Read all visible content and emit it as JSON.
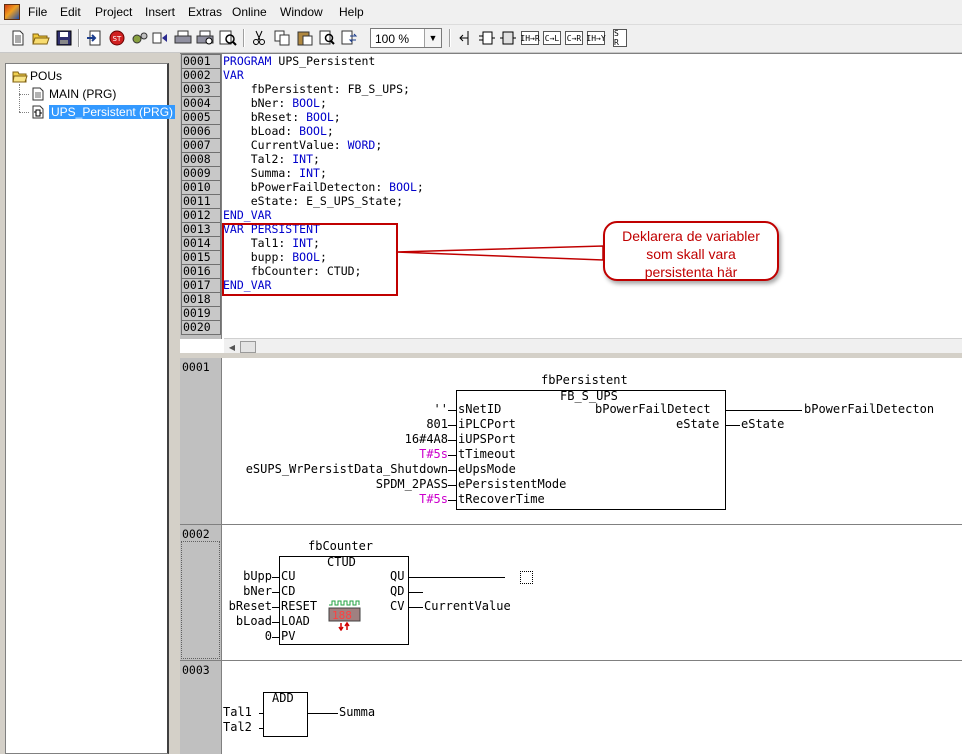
{
  "menu": [
    "File",
    "Edit",
    "Project",
    "Insert",
    "Extras",
    "Online",
    "Window",
    "Help"
  ],
  "toolbar": {
    "zoom": "100 %",
    "buttons": [
      "new-icon",
      "open-icon",
      "save-icon",
      "login-icon",
      "stop-icon",
      "build-icon",
      "print-icon",
      "print-preview-icon",
      "run-icon",
      "cut-icon",
      "copy-icon",
      "paste-icon",
      "find-icon",
      "find-next-icon",
      "insert-network-icon",
      "insert-box-icon",
      "insert-input-icon",
      "insert-contact-icon",
      "insert-coil-icon",
      "insert-negation-icon",
      "insert-jump-icon",
      "insert-set-reset-icon"
    ],
    "button_glyphs": [
      "IH→R",
      "C→L",
      "C→R",
      "IH→Y",
      "S R"
    ]
  },
  "tree": {
    "root": "POUs",
    "items": [
      "MAIN (PRG)",
      "UPS_Persistent (PRG)"
    ],
    "selected_index": 1
  },
  "declaration": {
    "line_numbers": [
      "0001",
      "0002",
      "0003",
      "0004",
      "0005",
      "0006",
      "0007",
      "0008",
      "0009",
      "0010",
      "0011",
      "0012",
      "0013",
      "0014",
      "0015",
      "0016",
      "0017",
      "0018",
      "0019",
      "0020"
    ],
    "lines": [
      [
        {
          "t": "PROGRAM ",
          "k": "kw"
        },
        {
          "t": "UPS_Persistent",
          "k": ""
        }
      ],
      [
        {
          "t": "VAR",
          "k": "kw"
        }
      ],
      [
        {
          "t": "    fbPersistent: FB_S_UPS;",
          "k": ""
        }
      ],
      [
        {
          "t": "    bNer: ",
          "k": ""
        },
        {
          "t": "BOOL",
          "k": "kw"
        },
        {
          "t": ";",
          "k": ""
        }
      ],
      [
        {
          "t": "    bReset: ",
          "k": ""
        },
        {
          "t": "BOOL",
          "k": "kw"
        },
        {
          "t": ";",
          "k": ""
        }
      ],
      [
        {
          "t": "    bLoad: ",
          "k": ""
        },
        {
          "t": "BOOL",
          "k": "kw"
        },
        {
          "t": ";",
          "k": ""
        }
      ],
      [
        {
          "t": "    CurrentValue: ",
          "k": ""
        },
        {
          "t": "WORD",
          "k": "kw"
        },
        {
          "t": ";",
          "k": ""
        }
      ],
      [
        {
          "t": "    Tal2: ",
          "k": ""
        },
        {
          "t": "INT",
          "k": "kw"
        },
        {
          "t": ";",
          "k": ""
        }
      ],
      [
        {
          "t": "    Summa: ",
          "k": ""
        },
        {
          "t": "INT",
          "k": "kw"
        },
        {
          "t": ";",
          "k": ""
        }
      ],
      [
        {
          "t": "    bPowerFailDetecton: ",
          "k": ""
        },
        {
          "t": "BOOL",
          "k": "kw"
        },
        {
          "t": ";",
          "k": ""
        }
      ],
      [
        {
          "t": "    eState: E_S_UPS_State;",
          "k": ""
        }
      ],
      [
        {
          "t": "END_VAR",
          "k": "kw"
        }
      ],
      [
        {
          "t": "VAR PERSISTENT",
          "k": "kw"
        }
      ],
      [
        {
          "t": "    Tal1: ",
          "k": ""
        },
        {
          "t": "INT",
          "k": "kw"
        },
        {
          "t": ";",
          "k": ""
        }
      ],
      [
        {
          "t": "    bupp: ",
          "k": ""
        },
        {
          "t": "BOOL",
          "k": "kw"
        },
        {
          "t": ";",
          "k": ""
        }
      ],
      [
        {
          "t": "    fbCounter: CTUD;",
          "k": ""
        }
      ],
      [
        {
          "t": "END_VAR",
          "k": "kw"
        }
      ],
      [
        {
          "t": "",
          "k": ""
        }
      ],
      [
        {
          "t": "",
          "k": ""
        }
      ],
      [
        {
          "t": "",
          "k": ""
        }
      ]
    ],
    "callout": [
      "Deklarera de variabler",
      "som skall vara",
      "persistenta här"
    ]
  },
  "networks": {
    "n1": {
      "number": "0001",
      "instance": "fbPersistent",
      "type": "FB_S_UPS",
      "inputs": [
        {
          "value": "''",
          "pin": "sNetID",
          "lit": false
        },
        {
          "value": "801",
          "pin": "iPLCPort",
          "lit": false
        },
        {
          "value": "16#4A8",
          "pin": "iUPSPort",
          "lit": false
        },
        {
          "value": "T#5s",
          "pin": "tTimeout",
          "lit": true
        },
        {
          "value": "eSUPS_WrPersistData_Shutdown",
          "pin": "eUpsMode",
          "lit": false
        },
        {
          "value": "SPDM_2PASS",
          "pin": "ePersistentMode",
          "lit": false
        },
        {
          "value": "T#5s",
          "pin": "tRecoverTime",
          "lit": true
        }
      ],
      "outputs": [
        {
          "pin": "bPowerFailDetect",
          "target": "bPowerFailDetecton"
        },
        {
          "pin": "eState",
          "target": "eState"
        }
      ]
    },
    "n2": {
      "number": "0002",
      "instance": "fbCounter",
      "type": "CTUD",
      "inputs": [
        {
          "value": "bUpp",
          "pin": "CU"
        },
        {
          "value": "bNer",
          "pin": "CD"
        },
        {
          "value": "bReset",
          "pin": "RESET"
        },
        {
          "value": "bLoad",
          "pin": "LOAD"
        },
        {
          "value": "0",
          "pin": "PV"
        }
      ],
      "outputs": [
        {
          "pin": "QU",
          "target": ""
        },
        {
          "pin": "QD",
          "target": ""
        },
        {
          "pin": "CV",
          "target": "CurrentValue"
        }
      ],
      "counter_display": "188"
    },
    "n3": {
      "number": "0003",
      "type": "ADD",
      "inputs": [
        "Tal1",
        "Tal2"
      ],
      "output": "Summa"
    }
  }
}
